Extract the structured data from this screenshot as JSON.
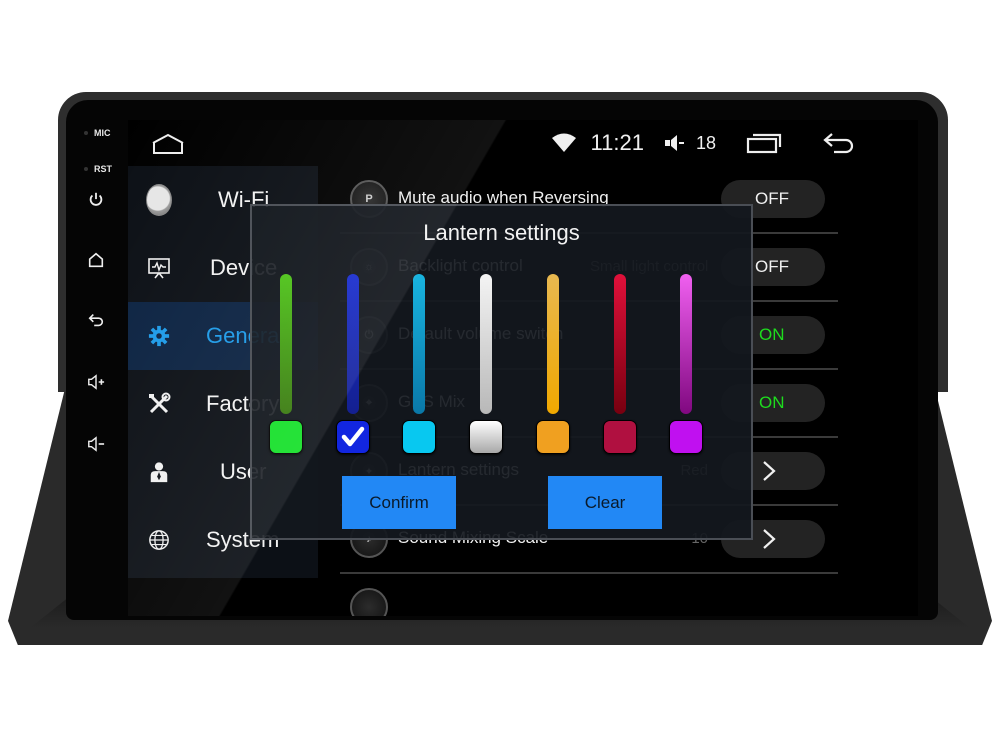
{
  "hardware": {
    "mic_label": "MIC",
    "rst_label": "RST",
    "buttons": [
      {
        "icon": "power-icon"
      },
      {
        "icon": "home-icon"
      },
      {
        "icon": "back-icon"
      },
      {
        "icon": "volume-up-icon"
      },
      {
        "icon": "volume-down-icon"
      }
    ]
  },
  "statusbar": {
    "time": "11:21",
    "volume": "18",
    "icons": [
      "home-icon",
      "wifi-icon",
      "volume-icon",
      "recent-apps-icon",
      "back-icon"
    ]
  },
  "sidebar": {
    "items": [
      {
        "label": "Wi-Fi",
        "icon": "knob-icon",
        "active": false
      },
      {
        "label": "Device",
        "icon": "device-monitor-icon",
        "active": false
      },
      {
        "label": "General",
        "icon": "gear-icon",
        "active": true
      },
      {
        "label": "Factory",
        "icon": "tools-icon",
        "active": false
      },
      {
        "label": "User",
        "icon": "user-icon",
        "active": false
      },
      {
        "label": "System",
        "icon": "globe-icon",
        "active": false
      }
    ],
    "accent": "#1e9be8"
  },
  "settings": {
    "rows": [
      {
        "label": "Mute audio when Reversing",
        "sub": "",
        "value": "",
        "control": "OFF",
        "control_type": "toggle",
        "icon_text": "P"
      },
      {
        "label": "Backlight control",
        "sub": "Small light control",
        "value": "",
        "control": "OFF",
        "control_type": "toggle",
        "icon_text": "☼"
      },
      {
        "label": "Default volume switch",
        "sub": "",
        "value": "",
        "control": "ON",
        "control_type": "toggle",
        "icon_text": "⏻"
      },
      {
        "label": "GPS Mix",
        "sub": "",
        "value": "",
        "control": "ON",
        "control_type": "toggle",
        "icon_text": "⌖"
      },
      {
        "label": "Lantern settings",
        "sub": "",
        "value": "Red",
        "control": "›",
        "control_type": "arrow",
        "icon_text": "✦"
      },
      {
        "label": "Sound Mixing Scale",
        "sub": "",
        "value": "10",
        "control": "›",
        "control_type": "arrow",
        "icon_text": "♪"
      }
    ],
    "on_color": "#1edc1e"
  },
  "dialog": {
    "title": "Lantern settings",
    "colors": [
      {
        "name": "green",
        "bar_top": "#4fc41a",
        "bar_bottom": "#3a7a10",
        "swatch": "#16e02a",
        "selected": false
      },
      {
        "name": "blue",
        "bar_top": "#1a2ed0",
        "bar_bottom": "#142090",
        "swatch": "#1226e0",
        "selected": true
      },
      {
        "name": "cyan",
        "bar_top": "#18b4e0",
        "bar_bottom": "#0a78a8",
        "swatch": "#08c8f0",
        "selected": false
      },
      {
        "name": "white",
        "bar_top": "#f4f4f4",
        "bar_bottom": "#b8b8b8",
        "swatch": "#e6e6e6",
        "selected": false
      },
      {
        "name": "orange",
        "bar_top": "#e8b850",
        "bar_bottom": "#f0a800",
        "swatch": "#f0a020",
        "selected": false
      },
      {
        "name": "red",
        "bar_top": "#e0103a",
        "bar_bottom": "#780010",
        "swatch": "#b01040",
        "selected": false
      },
      {
        "name": "purple",
        "bar_top": "#f060f0",
        "bar_bottom": "#800880",
        "swatch": "#c010f0",
        "selected": false
      }
    ],
    "confirm_label": "Confirm",
    "clear_label": "Clear",
    "button_color": "#2288f5"
  }
}
